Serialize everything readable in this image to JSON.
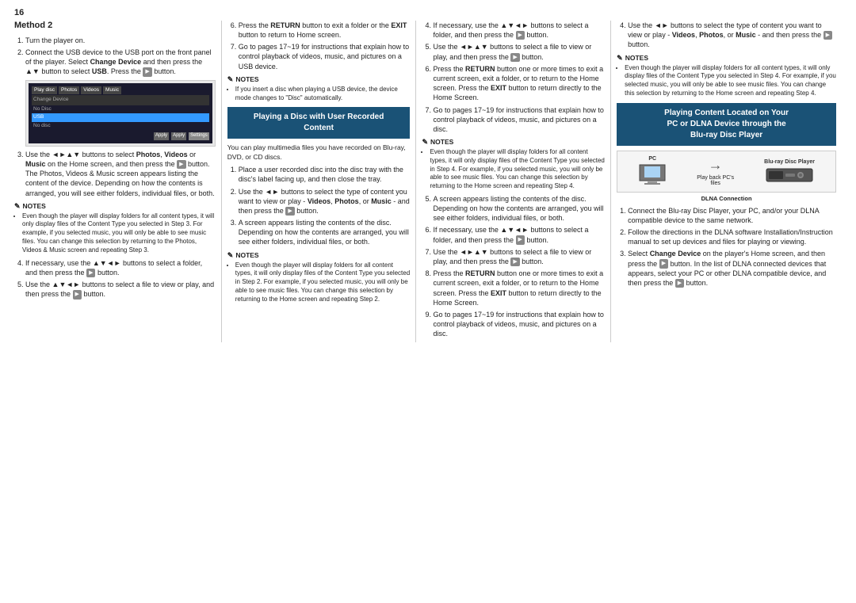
{
  "page": {
    "number": "16",
    "method2": {
      "title": "Method 2",
      "steps": [
        "Turn the player on.",
        "Connect the USB device to the USB port on the front panel of the player. Select Change Device and then press the ▲▼ button to select USB. Press the button.",
        "Use the ◄►▲▼ buttons to select Photos, Videos or Music on the Home screen, and then press the button. The Photos, Videos & Music screen appears listing the content of the device. Depending on how the contents is arranged, you will see either folders, individual files, or both.",
        "If necessary, use the ▲▼◄► buttons to select a folder, and then press the button.",
        "Use the ▲▼◄► buttons to select a file to view or play, and then press the button."
      ],
      "notes": {
        "title": "NOTES",
        "items": [
          "Even though the player will display folders for all content types, it will only display files of the Content Type you selected in Step 3. For example, if you selected music, you will only be able to see music files. You can change this selection by returning to the Photos, Videos & Music screen and repeating Step 3."
        ]
      }
    },
    "col2": {
      "steps_top": [
        "Press the RETURN button to exit a folder or the EXIT button to return to Home screen.",
        "Go to pages 17~19 for instructions that explain how to control playback of videos, music, and pictures on a USB device."
      ],
      "notes_top": {
        "title": "NOTES",
        "items": [
          "If you insert a disc when playing a USB device, the device mode changes to \"Disc\" automatically."
        ]
      },
      "highlight_box": {
        "line1": "Playing a Disc with User Recorded",
        "line2": "Content"
      },
      "intro": "You can play multimedia files you have recorded on Blu-ray, DVD, or CD discs.",
      "steps_bottom": [
        "Place a user recorded disc into the disc tray with the disc's label facing up, and then close the tray.",
        "Use the ◄► buttons to select the type of content you want to view or play - Videos, Photos, or Music - and then press the button.",
        "A screen appears listing the contents of the disc. Depending on how the contents are arranged, you will see either folders, individual files, or both."
      ],
      "notes_bottom": {
        "title": "NOTES",
        "items": [
          "Even though the player will display folders for all content types, it will only display files of the Content Type you selected in Step 2. For example, if you selected music, you will only be able to see music files. You can change this selection by returning to the Home screen and repeating Step 2."
        ]
      }
    },
    "col3": {
      "steps": [
        "If necessary, use the ▲▼◄► buttons to select a folder, and then press the button.",
        "Use the ◄►▲▼ buttons to select a file to view or play, and then press the button.",
        "Press the RETURN button one or more times to exit a current screen, exit a folder, or to return to the Home screen. Press the EXIT button to return directly to the Home Screen.",
        "Go to pages 17~19 for instructions that explain how to control playback of videos, music, and pictures on a disc."
      ],
      "notes": {
        "title": "NOTES",
        "items": [
          "Even though the player will display folders for all content types, it will only display files of the Content Type you selected in Step 4. For example, if you selected music, you will only be able to see music files. You can change this selection by returning to the Home screen and repeating Step 4."
        ]
      }
    },
    "col4": {
      "step4_pre": "Use the ◄► buttons to select the type of content you want to view or play - Videos, Photos, or Music - and then press the button.",
      "notes": {
        "title": "NOTES",
        "items": [
          "Even though the player will display folders for all content types, it will only display files of the Content Type you selected in Step 4. For example, if you selected music, you will only be able to see music files. You can change this selection by returning to the Home screen and repeating Step 4."
        ]
      },
      "step5": "A screen appears listing the contents of the disc. Depending on how the contents are arranged, you will see either folders, individual files, or both.",
      "step6": "If necessary, use the ▲▼◄► buttons to select a folder, and then press the button.",
      "step7": "Use the ◄►▲▼ buttons to select a file to view or play, and then press the button.",
      "step8": "Press the RETURN button one or more times to exit a current screen, exit a folder, or to return to the Home screen. Press the EXIT button to return directly to the Home Screen.",
      "step9": "Go to pages 17~19 for instructions that explain how to control playback of videos, music, and pictures on a disc.",
      "highlight_box": {
        "line1": "Playing Content Located on Your",
        "line2": "PC or DLNA Device through the",
        "line3": "Blu-ray Disc Player"
      },
      "diagram": {
        "pc_label": "PC",
        "bluray_label": "Blu-ray Disc Player",
        "files_label": "Play back PC's\nfiles",
        "dlna_label": "DLNA Connection"
      },
      "steps_after": [
        "Connect the Blu-ray Disc Player, your PC, and/or your DLNA compatible device to the same network.",
        "Follow the directions in the DLNA software Installation/Instruction manual to set up devices and files for playing or viewing.",
        "Select Change Device on the player's Home screen, and then press the button. In the list of DLNA connected devices that appears, select your PC or other DLNA compatible device, and then press the button."
      ]
    }
  }
}
